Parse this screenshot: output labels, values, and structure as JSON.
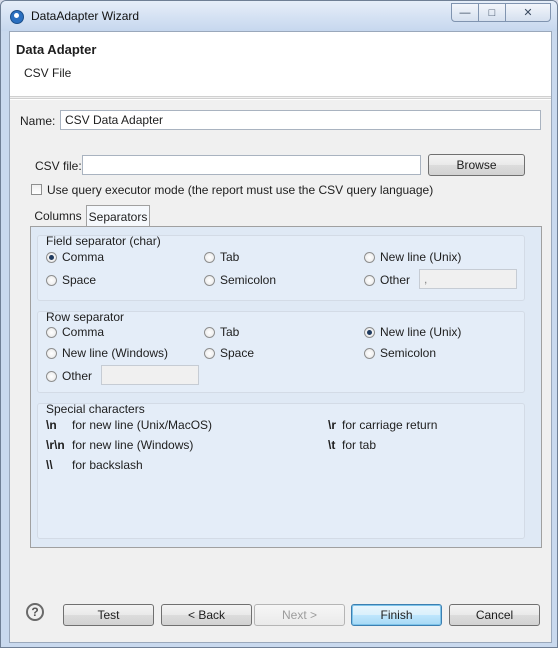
{
  "window": {
    "title": "DataAdapter Wizard",
    "minimize": "—",
    "restore": "□",
    "close": "✕"
  },
  "header": {
    "title": "Data Adapter",
    "subtitle": "CSV File"
  },
  "form": {
    "name_label": "Name:",
    "name_value": "CSV Data Adapter",
    "csv_label": "CSV file:",
    "csv_value": "",
    "browse_label": "Browse",
    "query_checkbox_label": "Use query executor mode (the report must use the CSV query language)",
    "query_checked": false
  },
  "tabs": [
    {
      "label": "Columns",
      "active": false
    },
    {
      "label": "Separators",
      "active": true
    }
  ],
  "field_separator": {
    "title": "Field separator (char)",
    "options": [
      {
        "label": "Comma",
        "selected": true
      },
      {
        "label": "Tab",
        "selected": false
      },
      {
        "label": "New line (Unix)",
        "selected": false
      },
      {
        "label": "Space",
        "selected": false
      },
      {
        "label": "Semicolon",
        "selected": false
      },
      {
        "label": "Other",
        "selected": false
      }
    ],
    "other_value": ","
  },
  "row_separator": {
    "title": "Row separator",
    "options": [
      {
        "label": "Comma",
        "selected": false
      },
      {
        "label": "Tab",
        "selected": false
      },
      {
        "label": "New line (Unix)",
        "selected": true
      },
      {
        "label": "New line (Windows)",
        "selected": false
      },
      {
        "label": "Space",
        "selected": false
      },
      {
        "label": "Semicolon",
        "selected": false
      },
      {
        "label": "Other",
        "selected": false
      }
    ],
    "other_value": ""
  },
  "special": {
    "title": "Special characters",
    "items": [
      {
        "code": "\\n",
        "desc": "for new line (Unix/MacOS)"
      },
      {
        "code": "\\r",
        "desc": "for carriage return"
      },
      {
        "code": "\\r\\n",
        "desc": "for new line (Windows)"
      },
      {
        "code": "\\t",
        "desc": "for tab"
      },
      {
        "code": "\\\\",
        "desc": "for backslash"
      }
    ]
  },
  "footer": {
    "help": "?",
    "test": "Test",
    "back": "< Back",
    "next": "Next >",
    "finish": "Finish",
    "cancel": "Cancel"
  }
}
